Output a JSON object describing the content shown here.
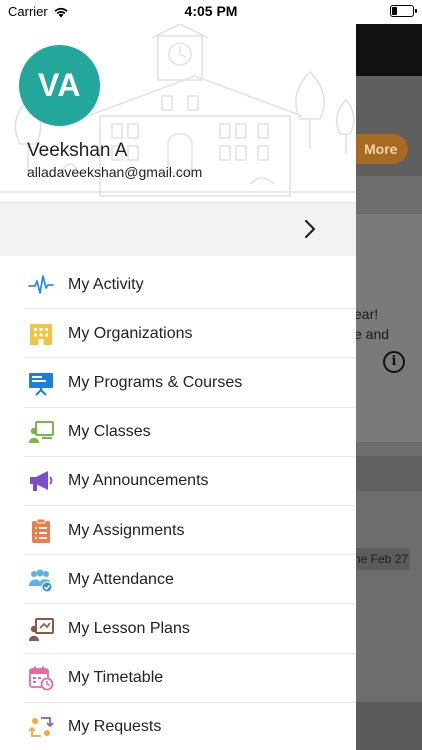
{
  "status_bar": {
    "carrier": "Carrier",
    "time": "4:05 PM"
  },
  "background_app": {
    "more_label": "More",
    "text_line1": "ear!",
    "text_line2": "e and",
    "info_glyph": "i",
    "date_chip": "ne Feb 27"
  },
  "drawer": {
    "avatar_initials": "VA",
    "user_name": "Veekshan A",
    "user_email": "alladaveekshan@gmail.com",
    "menu": [
      {
        "label": "My Activity",
        "icon": "activity-pulse-icon",
        "color": "#2f8ce5"
      },
      {
        "label": "My Organizations",
        "icon": "organization-building-icon",
        "color": "#f5c343"
      },
      {
        "label": "My Programs & Courses",
        "icon": "presentation-board-icon",
        "color": "#1f7fd6"
      },
      {
        "label": "My Classes",
        "icon": "class-teacher-board-icon",
        "color": "#7ab648"
      },
      {
        "label": "My Announcements",
        "icon": "megaphone-icon",
        "color": "#7a4fc9"
      },
      {
        "label": "My Assignments",
        "icon": "clipboard-list-icon",
        "color": "#ef7b4a"
      },
      {
        "label": "My Attendance",
        "icon": "attendance-group-icon",
        "color": "#5ab3e8"
      },
      {
        "label": "My Lesson Plans",
        "icon": "lesson-plan-board-icon",
        "color": "#8a5a44"
      },
      {
        "label": "My Timetable",
        "icon": "calendar-clock-icon",
        "color": "#e46aa0"
      },
      {
        "label": "My Requests",
        "icon": "requests-exchange-icon",
        "color": "#f0a93a"
      }
    ]
  }
}
